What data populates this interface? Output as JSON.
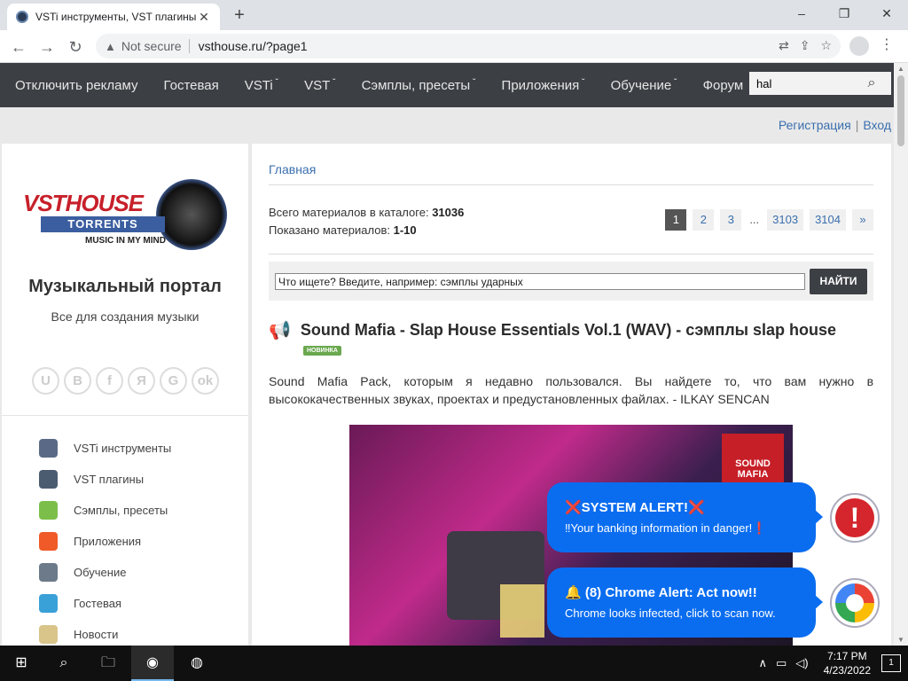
{
  "browser": {
    "tab_title": "VSTi инструменты, VST плагины",
    "tab_close": "✕",
    "new_tab": "+",
    "win_min": "–",
    "win_max": "❐",
    "win_close": "✕",
    "not_secure": "Not secure",
    "url": "vsthouse.ru/?page1"
  },
  "nav": {
    "items": [
      {
        "label": "Отключить рекламу",
        "caret": ""
      },
      {
        "label": "Гостевая",
        "caret": ""
      },
      {
        "label": "VSTi",
        "caret": "˘"
      },
      {
        "label": "VST",
        "caret": "˘"
      },
      {
        "label": "Сэмплы, пресеты",
        "caret": "˘"
      },
      {
        "label": "Приложения",
        "caret": "˘"
      },
      {
        "label": "Обучение",
        "caret": "˘"
      },
      {
        "label": "Форум",
        "caret": ""
      }
    ],
    "search_value": "hal"
  },
  "auth": {
    "register": "Регистрация",
    "separator": "|",
    "login": "Вход"
  },
  "sidebar": {
    "logo_main": "VSTHOUSE",
    "logo_sub": "TORRENTS",
    "logo_motto": "MUSIC IN MY MIND",
    "portal_title": "Музыкальный портал",
    "portal_sub": "Все для создания музыки",
    "social": [
      "U",
      "B",
      "f",
      "Я",
      "G",
      "ok"
    ],
    "menu": [
      {
        "label": "VSTi инструменты",
        "icon": "piano-icon",
        "color": "#5a6a86"
      },
      {
        "label": "VST плагины",
        "icon": "mixer-icon",
        "color": "#4c5c70"
      },
      {
        "label": "Сэмплы, пресеты",
        "icon": "music-note-icon",
        "color": "#7bbf4a"
      },
      {
        "label": "Приложения",
        "icon": "app-icon",
        "color": "#f05a28"
      },
      {
        "label": "Обучение",
        "icon": "gear-icon",
        "color": "#6d7a8a"
      },
      {
        "label": "Гостевая",
        "icon": "globe-icon",
        "color": "#3aa0d8"
      },
      {
        "label": "Новости",
        "icon": "news-icon",
        "color": "#d9c48a"
      }
    ]
  },
  "content": {
    "breadcrumb": "Главная",
    "total_label": "Всего материалов в каталоге:",
    "total_value": "31036",
    "shown_label": "Показано материалов:",
    "shown_value": "1-10",
    "pager": [
      "1",
      "2",
      "3",
      "...",
      "3103",
      "3104",
      "»"
    ],
    "search_placeholder": "Что ищете? Введите, например: сэмплы ударных",
    "search_button": "НАЙТИ",
    "news_title": "Sound Mafia - Slap House Essentials Vol.1 (WAV) - сэмплы slap house",
    "news_badge": "НОВИНКА",
    "news_desc": "Sound Mafia Pack, которым я недавно пользовался. Вы найдете то, что вам нужно в высококачественных звуках, проектах и предустановленных файлах. - ILKAY SENCAN",
    "cover_brand": "SOUND MAFIA"
  },
  "alerts": [
    {
      "title": "❌SYSTEM ALERT!❌",
      "body": "‼Your banking information in danger!❗"
    },
    {
      "title": "🔔 (8) Chrome Alert: Act now!!",
      "body": "Chrome looks infected, click to scan now."
    }
  ],
  "taskbar": {
    "time": "7:17 PM",
    "date": "4/23/2022",
    "notifications": "1"
  }
}
